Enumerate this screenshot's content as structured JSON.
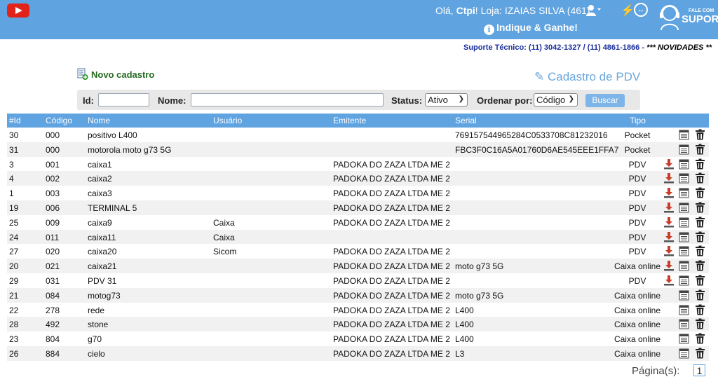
{
  "header": {
    "greeting_prefix": "Olá,",
    "user_name": "Ctpi",
    "greeting_mid": "! Loja:",
    "store": "IZAIAS SILVA (461)",
    "indique": "Indique & Ganhe!",
    "support_small": "FALE COM",
    "support_big": "SUPORT",
    "support_line": "Suporte Técnico: (11) 3042-1327 / (11) 4861-1866 -",
    "novidades": "*** NOVIDADES **"
  },
  "page": {
    "novo_cadastro": "Novo cadastro",
    "title": "Cadastro de PDV"
  },
  "filters": {
    "id_label": "Id:",
    "id_value": "",
    "nome_label": "Nome:",
    "nome_value": "",
    "status_label": "Status:",
    "status_value": "Ativo",
    "ordenar_label": "Ordenar por:",
    "ordenar_value": "Código",
    "buscar_label": "Buscar"
  },
  "table": {
    "columns": [
      "#Id",
      "Código",
      "Nome",
      "Usuário",
      "Emitente",
      "Serial",
      "Tipo"
    ],
    "rows": [
      {
        "id": "30",
        "codigo": "000",
        "nome": "positivo L400",
        "usuario": "",
        "emitente": "",
        "serial": "769157544965284C0533708C81232016",
        "tipo": "Pocket",
        "download": false
      },
      {
        "id": "31",
        "codigo": "000",
        "nome": "motorola moto g73 5G",
        "usuario": "",
        "emitente": "",
        "serial": "FBC3F0C16A5A01760D6AE545EEE1FFA7",
        "tipo": "Pocket",
        "download": false
      },
      {
        "id": "3",
        "codigo": "001",
        "nome": "caixa1",
        "usuario": "",
        "emitente": "PADOKA DO ZAZA LTDA ME 2",
        "serial": "",
        "tipo": "PDV",
        "download": true
      },
      {
        "id": "4",
        "codigo": "002",
        "nome": "caixa2",
        "usuario": "",
        "emitente": "PADOKA DO ZAZA LTDA ME 2",
        "serial": "",
        "tipo": "PDV",
        "download": true
      },
      {
        "id": "1",
        "codigo": "003",
        "nome": "caixa3",
        "usuario": "",
        "emitente": "PADOKA DO ZAZA LTDA ME 2",
        "serial": "",
        "tipo": "PDV",
        "download": true
      },
      {
        "id": "19",
        "codigo": "006",
        "nome": "TERMINAL 5",
        "usuario": "",
        "emitente": "PADOKA DO ZAZA LTDA ME 2",
        "serial": "",
        "tipo": "PDV",
        "download": true
      },
      {
        "id": "25",
        "codigo": "009",
        "nome": "caixa9",
        "usuario": "Caixa",
        "emitente": "PADOKA DO ZAZA LTDA ME 2",
        "serial": "",
        "tipo": "PDV",
        "download": true
      },
      {
        "id": "24",
        "codigo": "011",
        "nome": "caixa11",
        "usuario": "Caixa",
        "emitente": "",
        "serial": "",
        "tipo": "PDV",
        "download": true
      },
      {
        "id": "27",
        "codigo": "020",
        "nome": "caixa20",
        "usuario": "Sicom",
        "emitente": "PADOKA DO ZAZA LTDA ME 2",
        "serial": "",
        "tipo": "PDV",
        "download": true
      },
      {
        "id": "20",
        "codigo": "021",
        "nome": "caixa21",
        "usuario": "",
        "emitente": "PADOKA DO ZAZA LTDA ME 2",
        "serial": "moto g73 5G",
        "tipo": "Caixa online",
        "download": true
      },
      {
        "id": "29",
        "codigo": "031",
        "nome": "PDV 31",
        "usuario": "",
        "emitente": "PADOKA DO ZAZA LTDA ME 2",
        "serial": "",
        "tipo": "PDV",
        "download": true
      },
      {
        "id": "21",
        "codigo": "084",
        "nome": "motog73",
        "usuario": "",
        "emitente": "PADOKA DO ZAZA LTDA ME 2",
        "serial": "moto g73 5G",
        "tipo": "Caixa online",
        "download": false
      },
      {
        "id": "22",
        "codigo": "278",
        "nome": "rede",
        "usuario": "",
        "emitente": "PADOKA DO ZAZA LTDA ME 2",
        "serial": "L400",
        "tipo": "Caixa online",
        "download": false
      },
      {
        "id": "28",
        "codigo": "492",
        "nome": "stone",
        "usuario": "",
        "emitente": "PADOKA DO ZAZA LTDA ME 2",
        "serial": "L400",
        "tipo": "Caixa online",
        "download": false
      },
      {
        "id": "23",
        "codigo": "804",
        "nome": "g70",
        "usuario": "",
        "emitente": "PADOKA DO ZAZA LTDA ME 2",
        "serial": "L400",
        "tipo": "Caixa online",
        "download": false
      },
      {
        "id": "26",
        "codigo": "884",
        "nome": "cielo",
        "usuario": "",
        "emitente": "PADOKA DO ZAZA LTDA ME 2",
        "serial": "L3",
        "tipo": "Caixa online",
        "download": false
      }
    ]
  },
  "pager": {
    "label": "Página(s):",
    "current": "1"
  }
}
